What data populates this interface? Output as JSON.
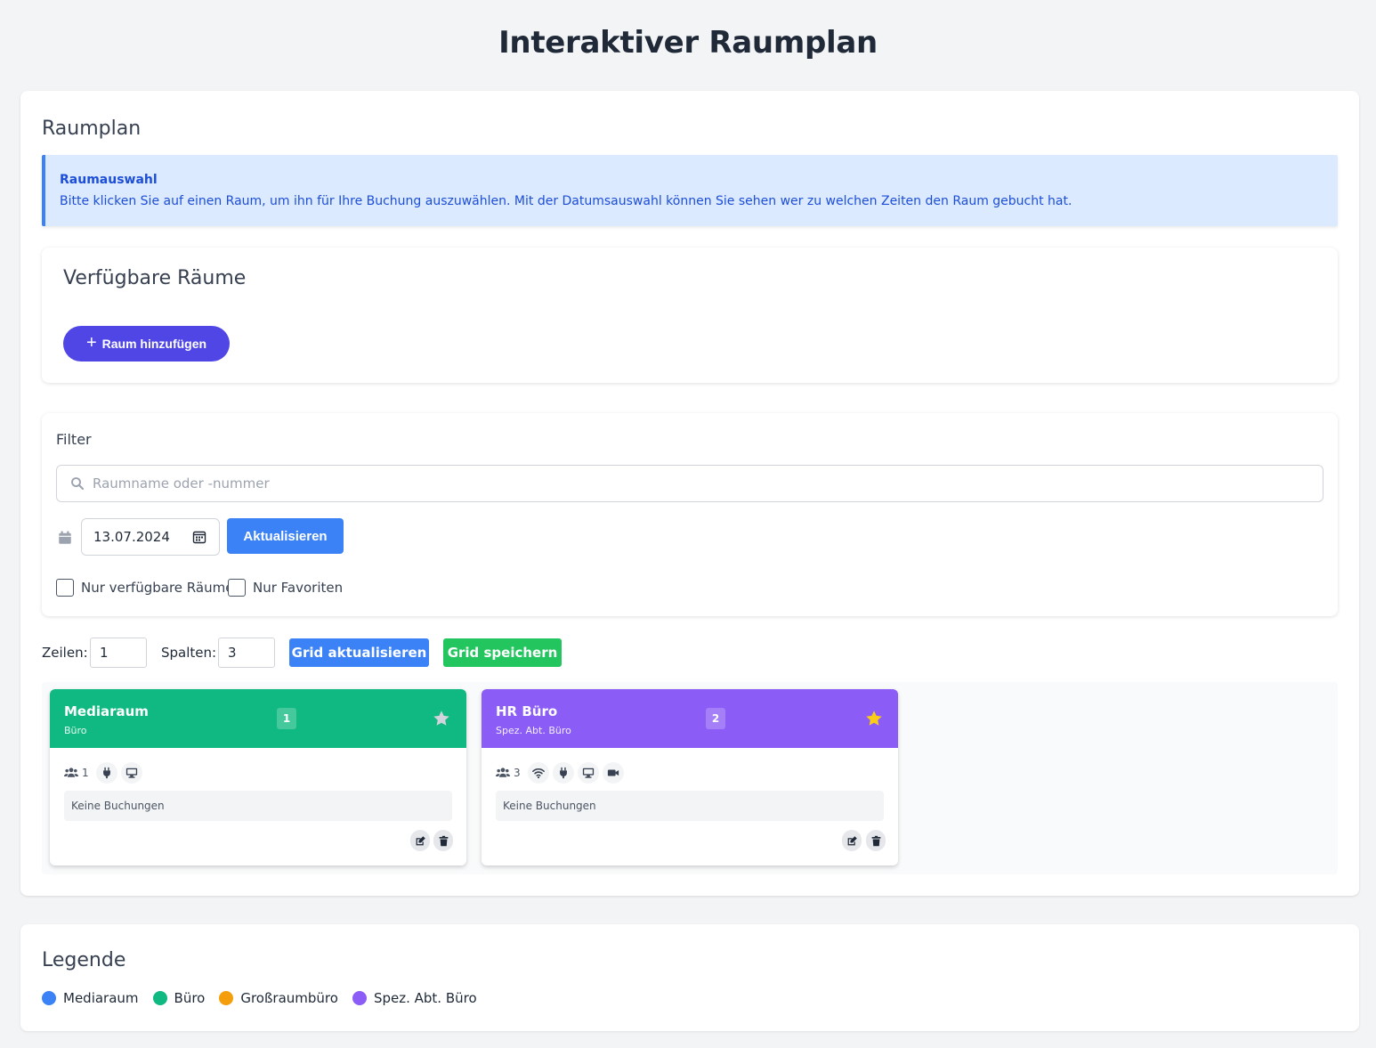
{
  "page": {
    "title": "Interaktiver Raumplan"
  },
  "raumplan": {
    "title": "Raumplan",
    "info": {
      "title": "Raumauswahl",
      "text": "Bitte klicken Sie auf einen Raum, um ihn für Ihre Buchung auszuwählen. Mit der Datumsauswahl können Sie sehen wer zu welchen Zeiten den Raum gebucht hat."
    },
    "available": {
      "title": "Verfügbare Räume",
      "add_label": "Raum hinzufügen"
    },
    "filter": {
      "title": "Filter",
      "search_placeholder": "Raumname oder -nummer",
      "search_value": "",
      "date_value": "13.07.2024",
      "refresh_label": "Aktualisieren",
      "only_available_label": "Nur verfügbare Räume",
      "only_available_checked": false,
      "only_favorites_label": "Nur Favoriten",
      "only_favorites_checked": false
    },
    "grid": {
      "rows_label": "Zeilen:",
      "rows_value": "1",
      "cols_label": "Spalten:",
      "cols_value": "3",
      "update_label": "Grid aktualisieren",
      "save_label": "Grid speichern"
    },
    "rooms": [
      {
        "name": "Mediaraum",
        "type": "Büro",
        "number": "1",
        "color": "#10b981",
        "favorite": false,
        "capacity": "1",
        "features": [
          "plug-icon",
          "monitor-icon"
        ],
        "bookings_text": "Keine Buchungen"
      },
      {
        "name": "HR Büro",
        "type": "Spez. Abt. Büro",
        "number": "2",
        "color": "#8b5cf6",
        "favorite": true,
        "capacity": "3",
        "features": [
          "wifi-icon",
          "plug-icon",
          "monitor-icon",
          "video-camera-icon"
        ],
        "bookings_text": "Keine Buchungen"
      }
    ]
  },
  "legend": {
    "title": "Legende",
    "items": [
      {
        "label": "Mediaraum",
        "color": "#3b82f6"
      },
      {
        "label": "Büro",
        "color": "#10b981"
      },
      {
        "label": "Großraumbüro",
        "color": "#f59e0b"
      },
      {
        "label": "Spez. Abt. Büro",
        "color": "#8b5cf6"
      }
    ]
  },
  "colors": {
    "primary": "#3b82f6",
    "success": "#22c55e",
    "indigo": "#4f46e5",
    "favorite_star": "#facc15"
  }
}
